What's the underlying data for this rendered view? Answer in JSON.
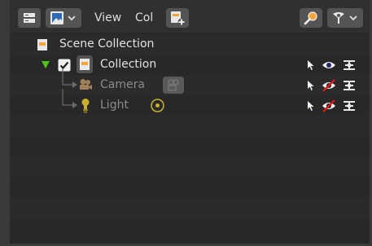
{
  "header": {
    "menu_view": "View",
    "menu_col": "Col"
  },
  "tree": [
    {
      "label": "Scene Collection",
      "icon": "scene-collection-icon",
      "dim": false
    },
    {
      "label": "Collection",
      "icon": "collection-icon",
      "checked": true,
      "expanded": true,
      "dim": false
    },
    {
      "label": "Camera",
      "icon": "camera-icon",
      "dim": true
    },
    {
      "label": "Light",
      "icon": "light-icon",
      "dim": true
    }
  ],
  "colors": {
    "background": "#282828",
    "header": "#303030",
    "text": "#e2e2e2",
    "dim_text": "#8b8b8b",
    "collection_orange": "#f6a33e",
    "camera_brown": "#a0805a",
    "light_yellow": "#c9b12f",
    "disabled_red": "#d21e1e",
    "expand_green": "#53c31b"
  }
}
